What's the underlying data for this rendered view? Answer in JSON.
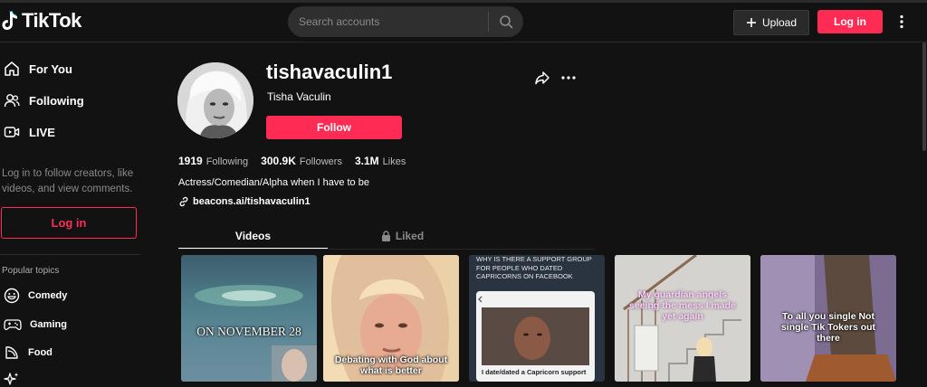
{
  "header": {
    "logo_text": "TikTok",
    "search_placeholder": "Search accounts",
    "upload_label": "Upload",
    "login_label": "Log in"
  },
  "sidebar": {
    "nav": [
      {
        "label": "For You",
        "icon": "home-icon"
      },
      {
        "label": "Following",
        "icon": "users-icon"
      },
      {
        "label": "LIVE",
        "icon": "live-icon"
      }
    ],
    "login_note": "Log in to follow creators, like videos, and view comments.",
    "login_button": "Log in",
    "topics_title": "Popular topics",
    "topics": [
      {
        "label": "Comedy",
        "icon": "comedy-icon"
      },
      {
        "label": "Gaming",
        "icon": "gaming-icon"
      },
      {
        "label": "Food",
        "icon": "food-icon"
      }
    ]
  },
  "profile": {
    "username": "tishavaculin1",
    "display_name": "Tisha Vaculin",
    "follow_label": "Follow",
    "stats": {
      "following_count": "1919",
      "following_label": "Following",
      "followers_count": "300.9K",
      "followers_label": "Followers",
      "likes_count": "3.1M",
      "likes_label": "Likes"
    },
    "bio": "Actress/Comedian/Alpha when I have to be",
    "link": "beacons.ai/tishavaculin1"
  },
  "tabs": {
    "videos": "Videos",
    "liked": "Liked"
  },
  "videos": [
    {
      "caption": "ON NOVEMBER 28"
    },
    {
      "caption": "Debating with God about what is better"
    },
    {
      "header": "WHY IS THERE A SUPPORT GROUP FOR PEOPLE WHO DATED CAPRICORNS ON FACEBOOK",
      "card_text": "I date/dated a Capricorn support"
    },
    {
      "caption": "My guardian angels seeing the mess I made yet again"
    },
    {
      "caption": "To all you single Not single Tik Tokers out there"
    }
  ],
  "colors": {
    "accent": "#fe2c55",
    "background": "#121212"
  }
}
